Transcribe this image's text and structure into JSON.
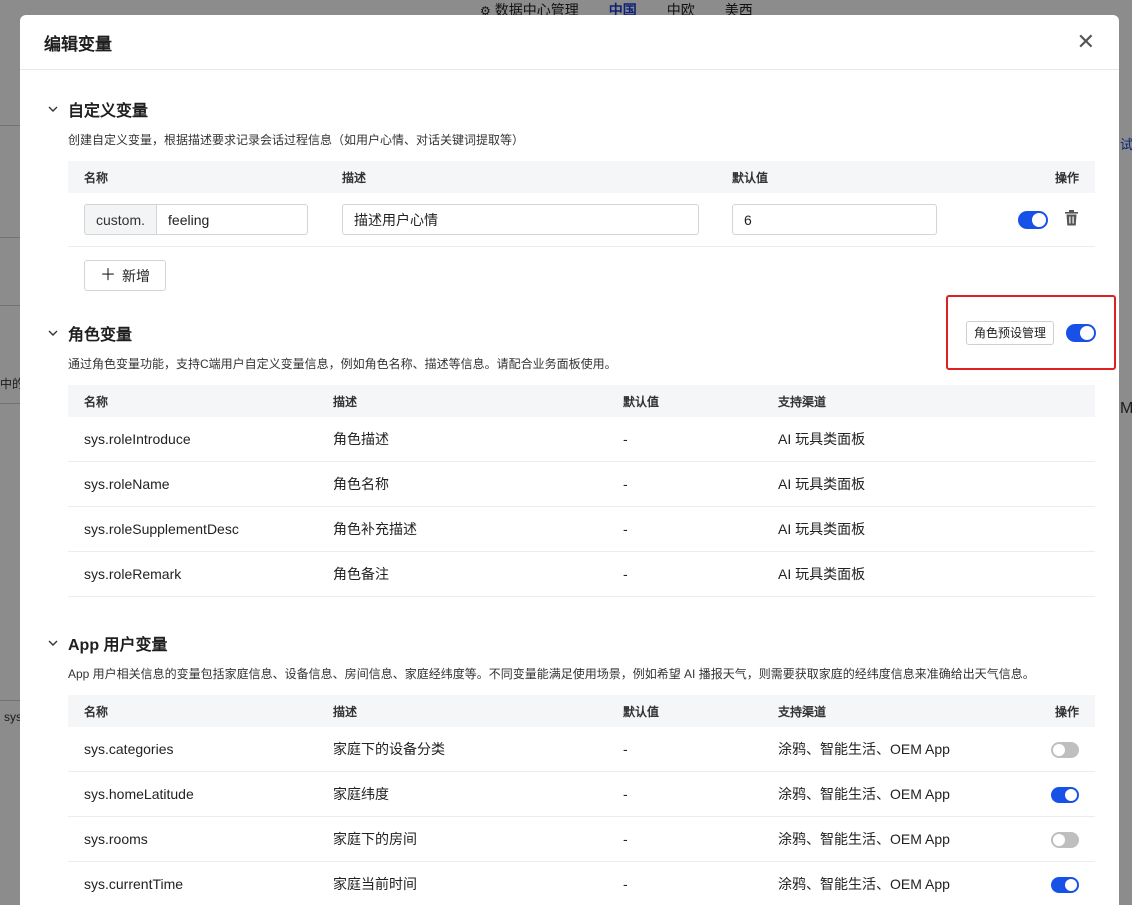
{
  "background": {
    "nav_items": [
      "数据中心管理",
      "中国",
      "中欧",
      "美西"
    ],
    "frag_test": "试",
    "frag_m": "M-",
    "frag_sys": "sys",
    "frag_mid": "中的"
  },
  "modal": {
    "title": "编辑变量",
    "close_icon": "close-icon"
  },
  "custom": {
    "title": "自定义变量",
    "description": "创建自定义变量，根据描述要求记录会话过程信息（如用户心情、对话关键词提取等）",
    "columns": [
      "名称",
      "描述",
      "默认值",
      "操作"
    ],
    "row": {
      "prefix": "custom.",
      "name_value": "feeling",
      "desc_value": "描述用户心情",
      "default_value": "6",
      "enabled": true
    },
    "add_label": "新增"
  },
  "role": {
    "title": "角色变量",
    "description": "通过角色变量功能，支持C端用户自定义变量信息，例如角色名称、描述等信息。请配合业务面板使用。",
    "preset_label": "角色预设管理",
    "enabled": true,
    "columns": [
      "名称",
      "描述",
      "默认值",
      "支持渠道"
    ],
    "rows": [
      {
        "name": "sys.roleIntroduce",
        "desc": "角色描述",
        "default": "-",
        "channel": "AI 玩具类面板"
      },
      {
        "name": "sys.roleName",
        "desc": "角色名称",
        "default": "-",
        "channel": "AI 玩具类面板"
      },
      {
        "name": "sys.roleSupplementDesc",
        "desc": "角色补充描述",
        "default": "-",
        "channel": "AI 玩具类面板"
      },
      {
        "name": "sys.roleRemark",
        "desc": "角色备注",
        "default": "-",
        "channel": "AI 玩具类面板"
      }
    ]
  },
  "app_user": {
    "title": "App 用户变量",
    "description": "App 用户相关信息的变量包括家庭信息、设备信息、房间信息、家庭经纬度等。不同变量能满足使用场景，例如希望 AI 播报天气，则需要获取家庭的经纬度信息来准确给出天气信息。",
    "columns": [
      "名称",
      "描述",
      "默认值",
      "支持渠道",
      "操作"
    ],
    "rows": [
      {
        "name": "sys.categories",
        "desc": "家庭下的设备分类",
        "default": "-",
        "channel": "涂鸦、智能生活、OEM App",
        "enabled": false
      },
      {
        "name": "sys.homeLatitude",
        "desc": "家庭纬度",
        "default": "-",
        "channel": "涂鸦、智能生活、OEM App",
        "enabled": true
      },
      {
        "name": "sys.rooms",
        "desc": "家庭下的房间",
        "default": "-",
        "channel": "涂鸦、智能生活、OEM App",
        "enabled": false
      },
      {
        "name": "sys.currentTime",
        "desc": "家庭当前时间",
        "default": "-",
        "channel": "涂鸦、智能生活、OEM App",
        "enabled": true
      }
    ]
  },
  "colors": {
    "accent": "#1751e8",
    "toggle_off": "#bfbfbf",
    "highlight_border": "#e02020"
  }
}
